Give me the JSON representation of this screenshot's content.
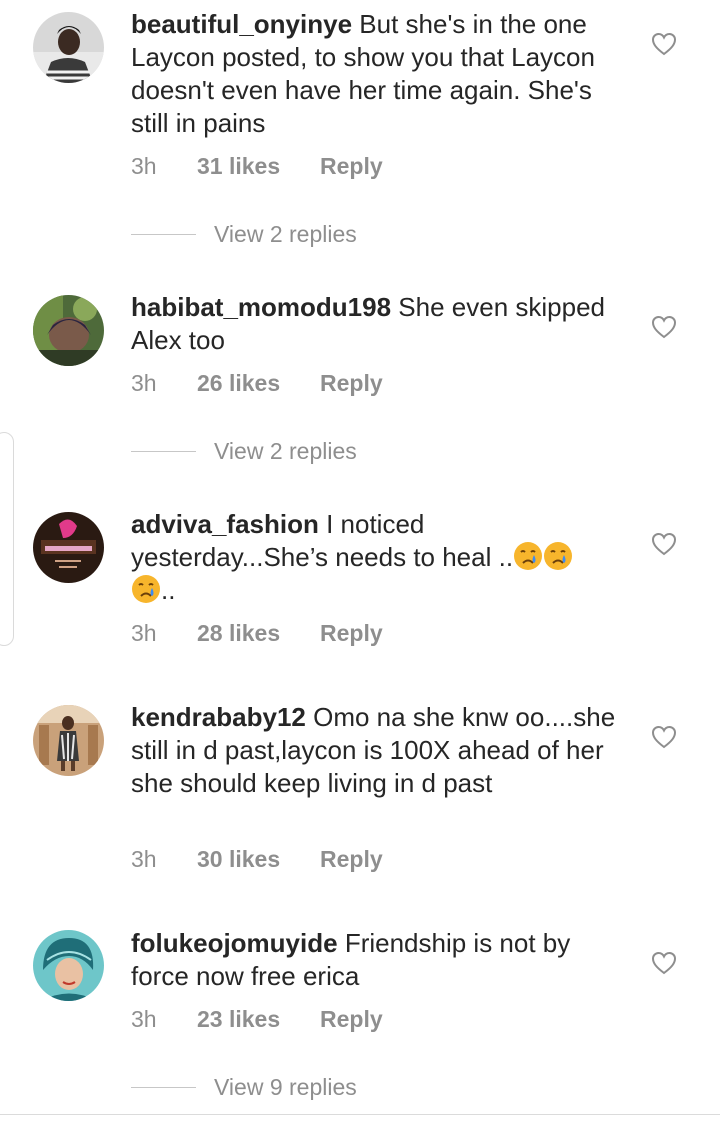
{
  "comments": [
    {
      "username": "beautiful_onyinye",
      "text": "But she's in the one Laycon posted, to show you that Laycon doesn't even have her time again. She's still in pains",
      "time": "3h",
      "likes": "31 likes",
      "reply": "Reply",
      "view_replies": "View 2 replies"
    },
    {
      "username": "habibat_momodu198",
      "text": "She even skipped Alex too",
      "time": "3h",
      "likes": "26 likes",
      "reply": "Reply",
      "view_replies": "View 2 replies"
    },
    {
      "username": "adviva_fashion",
      "text": "I noticed yesterday...She’s needs to heal ..",
      "text_tail": "..",
      "emoji": "crying-face",
      "time": "3h",
      "likes": "28 likes",
      "reply": "Reply"
    },
    {
      "username": "kendrababy12",
      "text": "Omo na she knw oo....she still in d past,laycon is 100X ahead of her she should keep living in d past",
      "time": "3h",
      "likes": "30 likes",
      "reply": "Reply"
    },
    {
      "username": "folukeojomuyide",
      "text": "Friendship is not by force now free erica",
      "time": "3h",
      "likes": "23 likes",
      "reply": "Reply",
      "view_replies": "View 9 replies"
    }
  ],
  "icons": {
    "like": "heart-outline-icon",
    "emoji": "crying-face-icon"
  },
  "colors": {
    "text": "#262626",
    "secondary": "#8e8e8e",
    "divider": "#c7c7c7"
  }
}
